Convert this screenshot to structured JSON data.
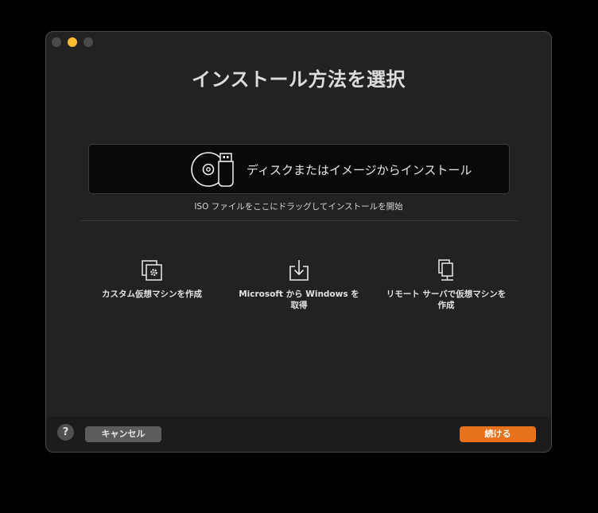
{
  "window": {
    "title": "インストール方法を選択"
  },
  "drop_zone": {
    "label": "ディスクまたはイメージからインストール",
    "hint": "ISO ファイルをここにドラッグしてインストールを開始",
    "icon": "disk-and-usb-icon"
  },
  "options": [
    {
      "label": "カスタム仮想マシンを作成",
      "icon": "custom-vm-gear-icon"
    },
    {
      "label": "Microsoft から Windows を取得",
      "icon": "download-icon"
    },
    {
      "label": "リモート サーバで仮想マシンを作成",
      "icon": "remote-server-icon"
    }
  ],
  "footer": {
    "help_label": "?",
    "cancel_label": "キャンセル",
    "continue_label": "続ける"
  },
  "colors": {
    "accent": "#e8711c",
    "window_bg": "#222224",
    "drop_zone_bg": "#0b0907"
  }
}
